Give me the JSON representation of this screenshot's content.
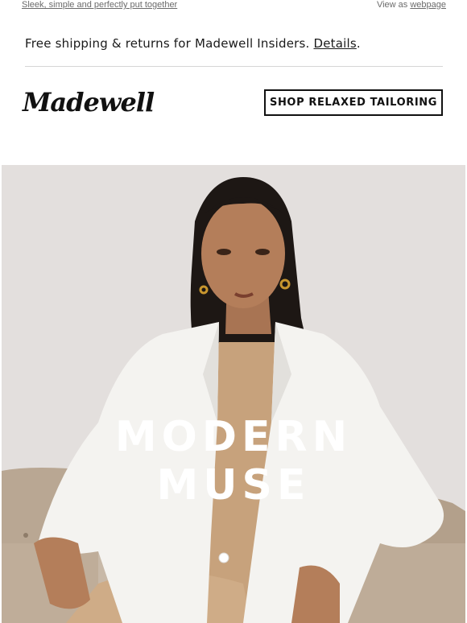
{
  "preheader": {
    "left_link": "Sleek, simple and perfectly put together",
    "view_as": "View as",
    "webpage_link": "webpage"
  },
  "banner": {
    "text": "Free shipping & returns for Madewell Insiders. ",
    "details_link": "Details",
    "period": "."
  },
  "header": {
    "logo_text": "Madewell",
    "cta_label": "SHOP RELAXED TAILORING"
  },
  "hero": {
    "title_line1": "MODERN",
    "title_line2": "MUSE"
  },
  "colors": {
    "background": "#ffffff",
    "text": "#111111",
    "muted": "#6b6b6b",
    "hero_bg": "#e6e3e1",
    "sofa": "#b9a793",
    "blazer": "#f4f3f0",
    "top": "#c7a27c"
  }
}
